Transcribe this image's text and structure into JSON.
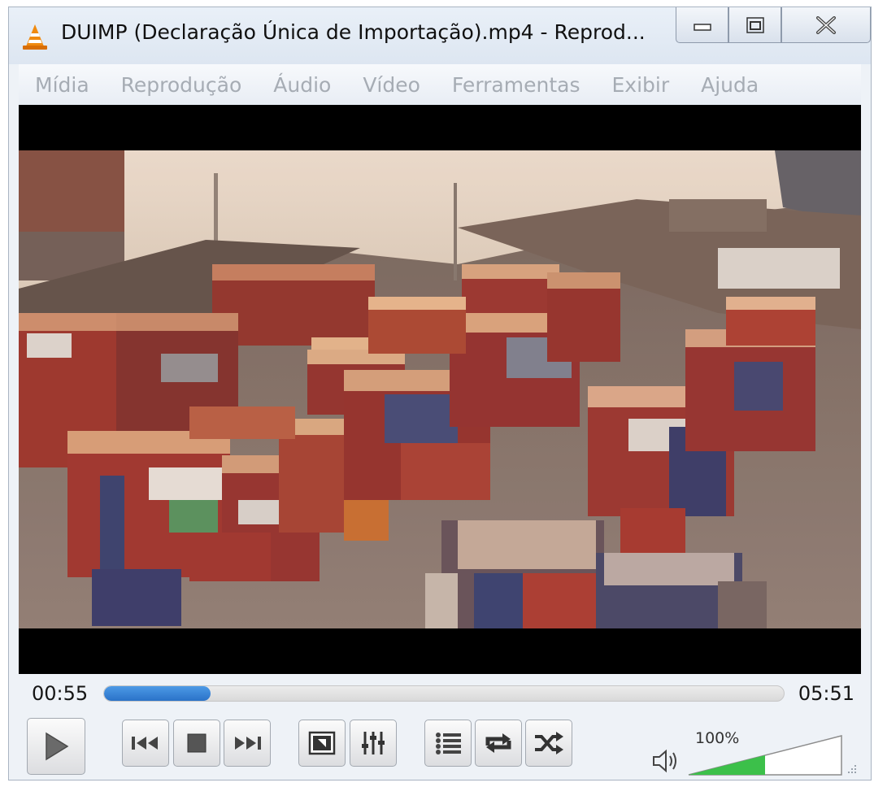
{
  "window": {
    "title": "DUIMP (Declaração Única de Importação).mp4 - Reprod...",
    "icon": "vlc-cone-icon"
  },
  "menu": [
    "Mídia",
    "Reprodução",
    "Áudio",
    "Vídeo",
    "Ferramentas",
    "Exibir",
    "Ajuda"
  ],
  "playback": {
    "current_time": "00:55",
    "total_time": "05:51",
    "progress_fraction": 0.157
  },
  "controls": {
    "buttons": [
      "play-icon",
      "previous-icon",
      "stop-icon",
      "next-icon",
      "fullscreen-icon",
      "equalizer-icon",
      "playlist-icon",
      "loop-icon",
      "shuffle-icon"
    ]
  },
  "volume": {
    "label": "100%",
    "level_fraction": 0.5
  },
  "colors": {
    "accent": "#2a72c8",
    "volume_green": "#3cc04a"
  }
}
